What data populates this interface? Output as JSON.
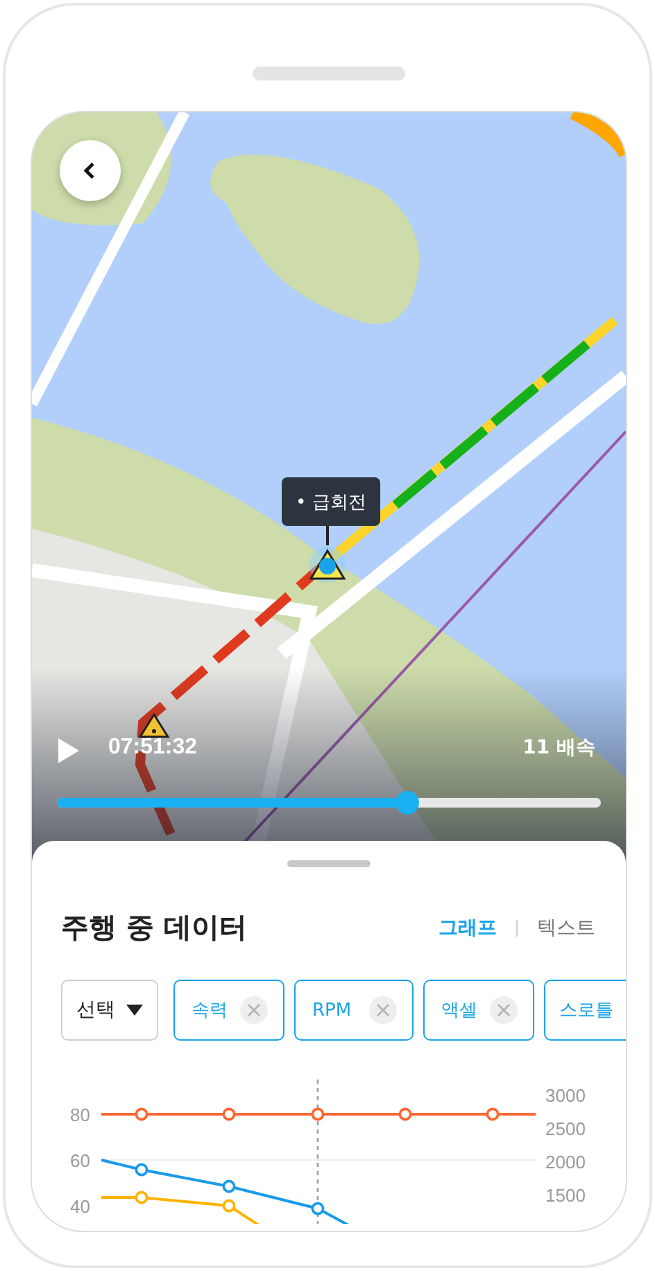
{
  "map": {
    "event_tooltip": "• 급회전"
  },
  "playback": {
    "time": "07:51:32",
    "speed": "11 배속",
    "level": 0.617
  },
  "sheet": {
    "title": "주행 중 데이터",
    "view_tabs": [
      {
        "label": "그래프",
        "selected": true
      },
      {
        "label": "텍스트",
        "selected": false
      }
    ],
    "select": "선택",
    "filters": [
      {
        "label": "속력"
      },
      {
        "label": "RPM"
      },
      {
        "label": "액셀"
      },
      {
        "label": "스로틀"
      }
    ],
    "chart": {
      "left_axis_labels": [
        "80",
        "60",
        "40"
      ],
      "right_axis_labels": [
        "3000",
        "2500",
        "2000",
        "1500"
      ]
    }
  }
}
